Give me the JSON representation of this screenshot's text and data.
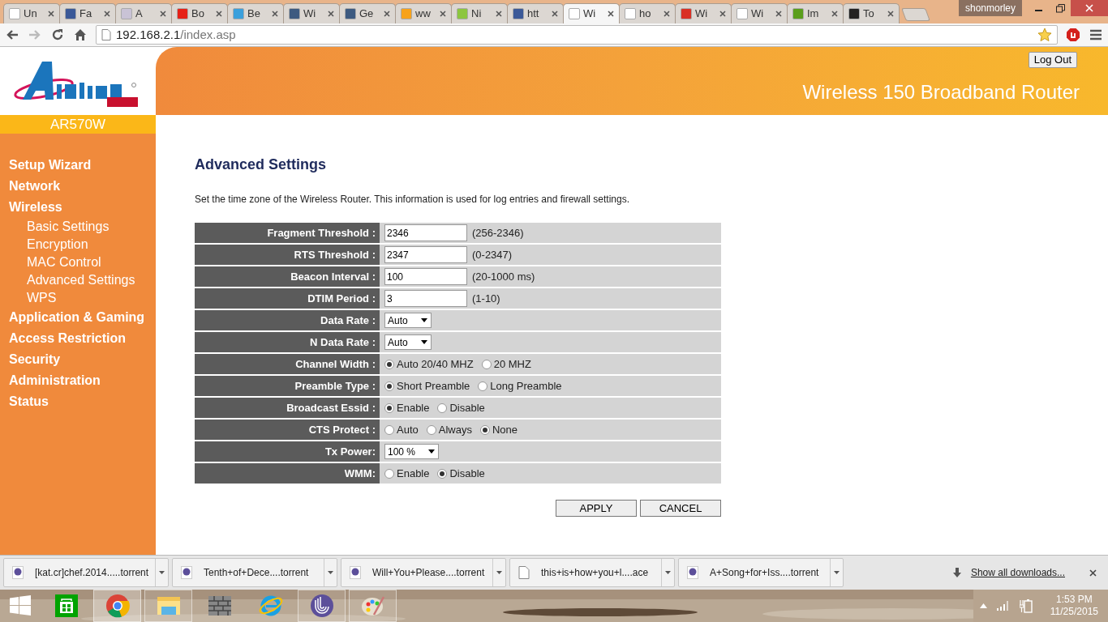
{
  "browser": {
    "tabs": [
      {
        "label": "Un",
        "selected": false
      },
      {
        "label": "Fa",
        "selected": false
      },
      {
        "label": "A",
        "selected": false
      },
      {
        "label": "Bo",
        "selected": false
      },
      {
        "label": "Be",
        "selected": false
      },
      {
        "label": "Wi",
        "selected": false
      },
      {
        "label": "Ge",
        "selected": false
      },
      {
        "label": "ww",
        "selected": false
      },
      {
        "label": "Ni",
        "selected": false
      },
      {
        "label": "htt",
        "selected": false
      },
      {
        "label": "Wi",
        "selected": true
      },
      {
        "label": "ho",
        "selected": false
      },
      {
        "label": "Wi",
        "selected": false
      },
      {
        "label": "Wi",
        "selected": false
      },
      {
        "label": "Im",
        "selected": false
      },
      {
        "label": "To",
        "selected": false
      }
    ],
    "profile": "shonmorley",
    "address": {
      "host": "192.168.2.1",
      "path": "/index.asp"
    }
  },
  "router": {
    "model": "AR570W",
    "logout": "Log Out",
    "title": "Wireless 150 Broadband Router",
    "nav": [
      {
        "label": "Setup Wizard"
      },
      {
        "label": "Network"
      },
      {
        "label": "Wireless",
        "children": [
          {
            "label": "Basic Settings"
          },
          {
            "label": "Encryption"
          },
          {
            "label": "MAC Control"
          },
          {
            "label": "Advanced Settings"
          },
          {
            "label": "WPS"
          }
        ]
      },
      {
        "label": "Application & Gaming"
      },
      {
        "label": "Access Restriction"
      },
      {
        "label": "Security"
      },
      {
        "label": "Administration"
      },
      {
        "label": "Status"
      }
    ],
    "heading": "Advanced Settings",
    "description": "Set the time zone of the Wireless Router. This information is used for log entries and firewall settings.",
    "rows": [
      {
        "label": "Fragment Threshold :",
        "kind": "text",
        "value": "2346",
        "hint": "(256-2346)"
      },
      {
        "label": "RTS Threshold :",
        "kind": "text",
        "value": "2347",
        "hint": "(0-2347)"
      },
      {
        "label": "Beacon Interval :",
        "kind": "text",
        "value": "100",
        "hint": "(20-1000 ms)"
      },
      {
        "label": "DTIM Period :",
        "kind": "text",
        "value": "3",
        "hint": "(1-10)"
      },
      {
        "label": "Data Rate :",
        "kind": "select",
        "value": "Auto"
      },
      {
        "label": "N Data Rate :",
        "kind": "select",
        "value": "Auto"
      },
      {
        "label": "Channel Width :",
        "kind": "radio",
        "options": [
          {
            "label": "Auto 20/40 MHZ",
            "selected": true
          },
          {
            "label": "20 MHZ",
            "selected": false
          }
        ]
      },
      {
        "label": "Preamble Type :",
        "kind": "radio",
        "options": [
          {
            "label": "Short Preamble",
            "selected": true
          },
          {
            "label": "Long Preamble",
            "selected": false
          }
        ]
      },
      {
        "label": "Broadcast Essid :",
        "kind": "radio",
        "options": [
          {
            "label": "Enable",
            "selected": true
          },
          {
            "label": "Disable",
            "selected": false
          }
        ]
      },
      {
        "label": "CTS Protect :",
        "kind": "radio",
        "options": [
          {
            "label": "Auto",
            "selected": false
          },
          {
            "label": "Always",
            "selected": false
          },
          {
            "label": "None",
            "selected": true
          }
        ]
      },
      {
        "label": "Tx Power:",
        "kind": "select",
        "value": "100 %"
      },
      {
        "label": "WMM:",
        "kind": "radio",
        "options": [
          {
            "label": "Enable",
            "selected": false
          },
          {
            "label": "Disable",
            "selected": true
          }
        ]
      }
    ],
    "buttons": [
      "APPLY",
      "CANCEL"
    ]
  },
  "downloads": {
    "items": [
      {
        "name": "[kat.cr]chef.2014.....torrent",
        "kind": "torrent"
      },
      {
        "name": "Tenth+of+Dece....torrent",
        "kind": "torrent"
      },
      {
        "name": "Will+You+Please....torrent",
        "kind": "torrent"
      },
      {
        "name": "this+is+how+you+l....ace",
        "kind": "file"
      },
      {
        "name": "A+Song+for+Iss....torrent",
        "kind": "torrent"
      }
    ],
    "show_all": "Show all downloads..."
  },
  "taskbar": {
    "apps": [
      {
        "kind": "store",
        "open": false,
        "selected": false
      },
      {
        "kind": "chrome",
        "open": true,
        "selected": true
      },
      {
        "kind": "explorer",
        "open": true,
        "selected": false
      },
      {
        "kind": "wall",
        "open": false,
        "selected": false
      },
      {
        "kind": "ie",
        "open": false,
        "selected": false
      },
      {
        "kind": "torrent",
        "open": true,
        "selected": false
      },
      {
        "kind": "paint",
        "open": true,
        "selected": false
      }
    ],
    "time": "1:53 PM",
    "date": "11/25/2015"
  }
}
